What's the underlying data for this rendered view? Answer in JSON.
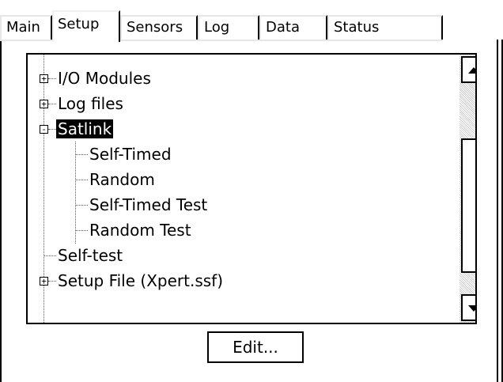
{
  "tabs": [
    {
      "label": "Main",
      "active": false
    },
    {
      "label": "Setup",
      "active": true
    },
    {
      "label": "Sensors",
      "active": false
    },
    {
      "label": "Log",
      "active": false
    },
    {
      "label": "Data",
      "active": false
    },
    {
      "label": "Status",
      "active": false
    }
  ],
  "tree": {
    "items": [
      {
        "label": "I/O Modules",
        "expander": "+"
      },
      {
        "label": "Log files",
        "expander": "+"
      },
      {
        "label": "Satlink",
        "expander": "-",
        "selected": true
      },
      {
        "label": "Self-Timed"
      },
      {
        "label": "Random"
      },
      {
        "label": "Self-Timed Test"
      },
      {
        "label": "Random Test"
      },
      {
        "label": "Self-test"
      },
      {
        "label": "Setup File (Xpert.ssf)",
        "expander": "+"
      }
    ]
  },
  "scrollbar": {
    "up_icon": "arrow-up-icon",
    "down_icon": "arrow-down-icon"
  },
  "edit_button": {
    "label": "Edit..."
  }
}
